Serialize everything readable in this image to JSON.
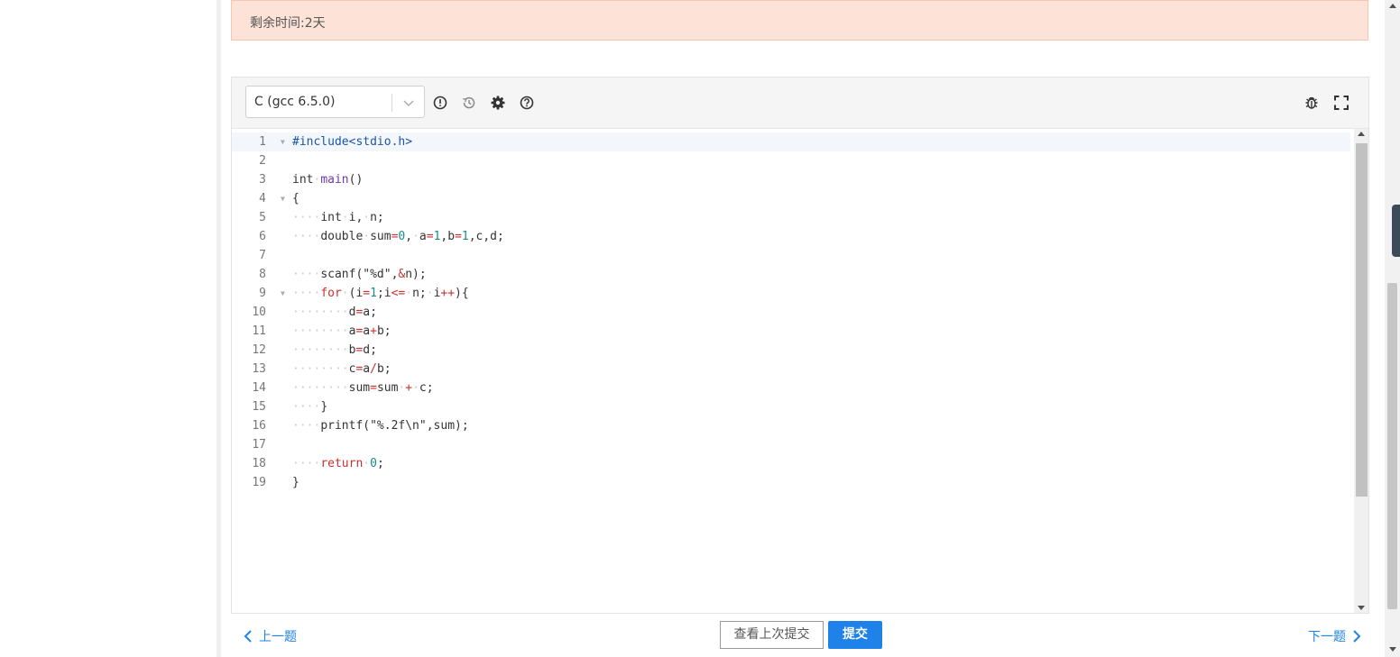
{
  "banner": {
    "remaining_time": "剩余时间:2天"
  },
  "editor": {
    "language": "C (gcc 6.5.0)",
    "toolbar_icons": [
      "info-circle-icon",
      "history-icon",
      "gear-icon",
      "help-circle-icon",
      "bug-icon",
      "fullscreen-icon"
    ],
    "active_line": 1,
    "lines": [
      {
        "n": "1",
        "fold": true,
        "tokens": [
          {
            "t": "#include<stdio.h>",
            "c": "#1a56a8"
          }
        ]
      },
      {
        "n": "2",
        "fold": false,
        "tokens": []
      },
      {
        "n": "3",
        "fold": false,
        "tokens": [
          {
            "t": "int",
            "c": "#333"
          },
          {
            "t": "·",
            "c": "#ccc"
          },
          {
            "t": "main",
            "c": "#6c3aa8"
          },
          {
            "t": "()",
            "c": "#333"
          }
        ]
      },
      {
        "n": "4",
        "fold": true,
        "tokens": [
          {
            "t": "{",
            "c": "#333"
          }
        ]
      },
      {
        "n": "5",
        "fold": false,
        "tokens": [
          {
            "t": "····",
            "c": "#ccc"
          },
          {
            "t": "int",
            "c": "#333"
          },
          {
            "t": "·",
            "c": "#ccc"
          },
          {
            "t": "i,",
            "c": "#333"
          },
          {
            "t": "·",
            "c": "#ccc"
          },
          {
            "t": "n;",
            "c": "#333"
          }
        ]
      },
      {
        "n": "6",
        "fold": false,
        "tokens": [
          {
            "t": "····",
            "c": "#ccc"
          },
          {
            "t": "double",
            "c": "#333"
          },
          {
            "t": "·",
            "c": "#ccc"
          },
          {
            "t": "sum",
            "c": "#333"
          },
          {
            "t": "=",
            "c": "#c9302c"
          },
          {
            "t": "0",
            "c": "#1a8a8a"
          },
          {
            "t": ",",
            "c": "#333"
          },
          {
            "t": "·",
            "c": "#ccc"
          },
          {
            "t": "a",
            "c": "#333"
          },
          {
            "t": "=",
            "c": "#c9302c"
          },
          {
            "t": "1",
            "c": "#1a8a8a"
          },
          {
            "t": ",b",
            "c": "#333"
          },
          {
            "t": "=",
            "c": "#c9302c"
          },
          {
            "t": "1",
            "c": "#1a8a8a"
          },
          {
            "t": ",c,d;",
            "c": "#333"
          }
        ]
      },
      {
        "n": "7",
        "fold": false,
        "tokens": []
      },
      {
        "n": "8",
        "fold": false,
        "tokens": [
          {
            "t": "····",
            "c": "#ccc"
          },
          {
            "t": "scanf(\"%d\",",
            "c": "#333"
          },
          {
            "t": "&",
            "c": "#c9302c"
          },
          {
            "t": "n);",
            "c": "#333"
          }
        ]
      },
      {
        "n": "9",
        "fold": true,
        "tokens": [
          {
            "t": "····",
            "c": "#ccc"
          },
          {
            "t": "for",
            "c": "#c9302c"
          },
          {
            "t": "·",
            "c": "#ccc"
          },
          {
            "t": "(i",
            "c": "#333"
          },
          {
            "t": "=",
            "c": "#c9302c"
          },
          {
            "t": "1",
            "c": "#1a8a8a"
          },
          {
            "t": ";i",
            "c": "#333"
          },
          {
            "t": "<=",
            "c": "#c9302c"
          },
          {
            "t": "·",
            "c": "#ccc"
          },
          {
            "t": "n;",
            "c": "#333"
          },
          {
            "t": "·",
            "c": "#ccc"
          },
          {
            "t": "i",
            "c": "#333"
          },
          {
            "t": "++",
            "c": "#c9302c"
          },
          {
            "t": "){",
            "c": "#333"
          }
        ]
      },
      {
        "n": "10",
        "fold": false,
        "tokens": [
          {
            "t": "········",
            "c": "#ccc"
          },
          {
            "t": "d",
            "c": "#333"
          },
          {
            "t": "=",
            "c": "#c9302c"
          },
          {
            "t": "a;",
            "c": "#333"
          }
        ]
      },
      {
        "n": "11",
        "fold": false,
        "tokens": [
          {
            "t": "········",
            "c": "#ccc"
          },
          {
            "t": "a",
            "c": "#333"
          },
          {
            "t": "=",
            "c": "#c9302c"
          },
          {
            "t": "a",
            "c": "#333"
          },
          {
            "t": "+",
            "c": "#c9302c"
          },
          {
            "t": "b;",
            "c": "#333"
          }
        ]
      },
      {
        "n": "12",
        "fold": false,
        "tokens": [
          {
            "t": "········",
            "c": "#ccc"
          },
          {
            "t": "b",
            "c": "#333"
          },
          {
            "t": "=",
            "c": "#c9302c"
          },
          {
            "t": "d;",
            "c": "#333"
          }
        ]
      },
      {
        "n": "13",
        "fold": false,
        "tokens": [
          {
            "t": "········",
            "c": "#ccc"
          },
          {
            "t": "c",
            "c": "#333"
          },
          {
            "t": "=",
            "c": "#c9302c"
          },
          {
            "t": "a",
            "c": "#333"
          },
          {
            "t": "/",
            "c": "#c9302c"
          },
          {
            "t": "b;",
            "c": "#333"
          }
        ]
      },
      {
        "n": "14",
        "fold": false,
        "tokens": [
          {
            "t": "········",
            "c": "#ccc"
          },
          {
            "t": "sum",
            "c": "#333"
          },
          {
            "t": "=",
            "c": "#c9302c"
          },
          {
            "t": "sum",
            "c": "#333"
          },
          {
            "t": "·",
            "c": "#ccc"
          },
          {
            "t": "+",
            "c": "#c9302c"
          },
          {
            "t": "·",
            "c": "#ccc"
          },
          {
            "t": "c;",
            "c": "#333"
          }
        ]
      },
      {
        "n": "15",
        "fold": false,
        "tokens": [
          {
            "t": "····",
            "c": "#ccc"
          },
          {
            "t": "}",
            "c": "#333"
          }
        ]
      },
      {
        "n": "16",
        "fold": false,
        "tokens": [
          {
            "t": "····",
            "c": "#ccc"
          },
          {
            "t": "printf(\"%.2f\\n\",sum);",
            "c": "#333"
          }
        ]
      },
      {
        "n": "17",
        "fold": false,
        "tokens": []
      },
      {
        "n": "18",
        "fold": false,
        "tokens": [
          {
            "t": "····",
            "c": "#ccc"
          },
          {
            "t": "return",
            "c": "#c9302c"
          },
          {
            "t": "·",
            "c": "#ccc"
          },
          {
            "t": "0",
            "c": "#1a8a8a"
          },
          {
            "t": ";",
            "c": "#333"
          }
        ]
      },
      {
        "n": "19",
        "fold": false,
        "tokens": [
          {
            "t": "}",
            "c": "#333"
          }
        ]
      }
    ]
  },
  "nav": {
    "prev_label": "上一题",
    "next_label": "下一题",
    "view_last_submission": "查看上次提交",
    "submit": "提交"
  },
  "colors": {
    "accent": "#1e82e8",
    "banner_bg": "#fde3d7"
  }
}
